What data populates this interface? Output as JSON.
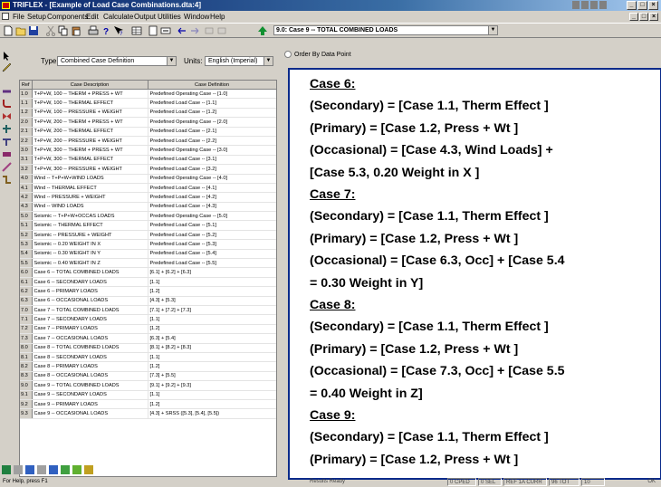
{
  "window": {
    "title": "TRIFLEX - [Example of Load Case Combinations.dta:4]",
    "controls": [
      "_",
      "□",
      "×"
    ]
  },
  "menubar": {
    "items": [
      "File",
      "Setup",
      "Components",
      "Edit",
      "Calculate",
      "Output",
      "Utilities",
      "Window",
      "Help"
    ]
  },
  "toolbar": {
    "case_selector": "9.0: Case 9 -- TOTAL COMBINED LOADS",
    "icons": [
      "new-icon",
      "open-icon",
      "save-icon",
      "cut-icon",
      "copy-icon",
      "paste-icon",
      "print-icon",
      "help-icon",
      "whats-this-icon",
      "grid-icon",
      "preview-icon",
      "export-icon",
      "arrow-left-icon",
      "arrow-right-icon",
      "page-first-icon",
      "page-last-icon",
      "up-arrow-icon"
    ]
  },
  "form": {
    "type_label": "Type:",
    "type_value": "Combined Case Definition",
    "units_label": "Units:",
    "units_value": "English (Imperial)",
    "order_option": "Order By Data Point"
  },
  "table": {
    "headers": [
      "Ref",
      "Case Description",
      "Case Definition"
    ],
    "rows": [
      [
        "1.0",
        "T+P+W, 100 -- THERM + PRESS + WT",
        "Predefined Operating Case -- [1.0]"
      ],
      [
        "1.1",
        "T+P+W, 100 -- THERMAL EFFECT",
        "Predefined Load Case -- [1.1]"
      ],
      [
        "1.2",
        "T+P+W, 100 -- PRESSURE + WEIGHT",
        "Predefined Load Case -- [1.2]"
      ],
      [
        "2.0",
        "T+P+W, 200 -- THERM + PRESS + WT",
        "Predefined Operating Case -- [2.0]"
      ],
      [
        "2.1",
        "T+P+W, 200 -- THERMAL EFFECT",
        "Predefined Load Case -- [2.1]"
      ],
      [
        "2.2",
        "T+P+W, 200 -- PRESSURE + WEIGHT",
        "Predefined Load Case -- [2.2]"
      ],
      [
        "3.0",
        "T+P+W, 300 -- THERM + PRESS + WT",
        "Predefined Operating Case -- [3.0]"
      ],
      [
        "3.1",
        "T+P+W, 300 -- THERMAL EFFECT",
        "Predefined Load Case -- [3.1]"
      ],
      [
        "3.2",
        "T+P+W, 300 -- PRESSURE + WEIGHT",
        "Predefined Load Case -- [3.2]"
      ],
      [
        "4.0",
        "Wind -- T+P+W+WIND LOADS",
        "Predefined Operating Case -- [4.0]"
      ],
      [
        "4.1",
        "Wind -- THERMAL EFFECT",
        "Predefined Load Case -- [4.1]"
      ],
      [
        "4.2",
        "Wind -- PRESSURE + WEIGHT",
        "Predefined Load Case -- [4.2]"
      ],
      [
        "4.3",
        "Wind -- WIND LOADS",
        "Predefined Load Case -- [4.3]"
      ],
      [
        "5.0",
        "Seismic -- T+P+W+OCCAS LOADS",
        "Predefined Operating Case -- [5.0]"
      ],
      [
        "5.1",
        "Seismic -- THERMAL EFFECT",
        "Predefined Load Case -- [5.1]"
      ],
      [
        "5.2",
        "Seismic -- PRESSURE + WEIGHT",
        "Predefined Load Case -- [5.2]"
      ],
      [
        "5.3",
        "Seismic -- 0.20 WEIGHT IN X",
        "Predefined Load Case -- [5.3]"
      ],
      [
        "5.4",
        "Seismic -- 0.30 WEIGHT IN Y",
        "Predefined Load Case -- [5.4]"
      ],
      [
        "5.5",
        "Seismic -- 0.40 WEIGHT IN Z",
        "Predefined Load Case -- [5.5]"
      ],
      [
        "6.0",
        "Case 6 -- TOTAL COMBINED LOADS",
        "[6.1] + [6.2] + [6.3]"
      ],
      [
        "6.1",
        "Case 6 -- SECONDARY LOADS",
        "[1.1]"
      ],
      [
        "6.2",
        "Case 6 -- PRIMARY LOADS",
        "[1.2]"
      ],
      [
        "6.3",
        "Case 6 -- OCCASIONAL LOADS",
        "[4.3] + [5.3]"
      ],
      [
        "7.0",
        "Case 7 -- TOTAL COMBINED LOADS",
        "[7.1] + [7.2] + [7.3]"
      ],
      [
        "7.1",
        "Case 7 -- SECONDARY LOADS",
        "[1.1]"
      ],
      [
        "7.2",
        "Case 7 -- PRIMARY LOADS",
        "[1.2]"
      ],
      [
        "7.3",
        "Case 7 -- OCCASIONAL LOADS",
        "[6.3] + [5.4]"
      ],
      [
        "8.0",
        "Case 8 -- TOTAL COMBINED LOADS",
        "[8.1] + [8.2] + [8.3]"
      ],
      [
        "8.1",
        "Case 8 -- SECONDARY LOADS",
        "[1.1]"
      ],
      [
        "8.2",
        "Case 8 -- PRIMARY LOADS",
        "[1.2]"
      ],
      [
        "8.3",
        "Case 8 -- OCCASIONAL LOADS",
        "[7.3] + [5.5]"
      ],
      [
        "9.0",
        "Case 9 -- TOTAL COMBINED LOADS",
        "[9.1] + [9.2] + [9.3]"
      ],
      [
        "9.1",
        "Case 9 -- SECONDARY LOADS",
        "[1.1]"
      ],
      [
        "9.2",
        "Case 9 -- PRIMARY LOADS",
        "[1.2]"
      ],
      [
        "9.3",
        "Case 9 -- OCCASIONAL LOADS",
        "[4.3] + SRSS ([5.3], [5.4], [5.5])"
      ]
    ]
  },
  "callout": {
    "lines": [
      {
        "text": "Case 6:",
        "heading": true
      },
      {
        "text": "(Secondary) = [Case 1.1, Therm Effect ]",
        "heading": false
      },
      {
        "text": "(Primary) = [Case 1.2, Press + Wt ]",
        "heading": false
      },
      {
        "text": "(Occasional) = [Case 4.3, Wind Loads] +",
        "heading": false
      },
      {
        "text": "[Case 5.3, 0.20 Weight in X ]",
        "heading": false
      },
      {
        "text": "Case 7:",
        "heading": true
      },
      {
        "text": "(Secondary) = [Case 1.1, Therm Effect ]",
        "heading": false
      },
      {
        "text": "(Primary) = [Case 1.2, Press + Wt ]",
        "heading": false
      },
      {
        "text": "(Occasional) = [Case 6.3, Occ] + [Case 5.4",
        "heading": false
      },
      {
        "text": "= 0.30 Weight in Y]",
        "heading": false
      },
      {
        "text": "Case 8:",
        "heading": true
      },
      {
        "text": "(Secondary) = [Case 1.1, Therm Effect ]",
        "heading": false
      },
      {
        "text": "(Primary) = [Case 1.2, Press + Wt ]",
        "heading": false
      },
      {
        "text": "(Occasional) = [Case 7.3, Occ] + [Case 5.5",
        "heading": false
      },
      {
        "text": "= 0.40 Weight in Z]",
        "heading": false
      },
      {
        "text": "Case 9:",
        "heading": true
      },
      {
        "text": "(Secondary) = [Case 1.1, Therm Effect ]",
        "heading": false
      },
      {
        "text": "(Primary) = [Case 1.2, Press + Wt ]",
        "heading": false
      }
    ]
  },
  "statusbar": {
    "help": "For Help, press F1",
    "state": "Results Ready",
    "panes": [
      "0 CPED",
      "0 SEL",
      "REF 1A CURR",
      "96 TOT",
      "10",
      "OK"
    ]
  },
  "colors": {
    "title_gradient_start": "#0a246a",
    "callout_border": "#0a2a8a",
    "window_bg": "#d4d0c8"
  }
}
